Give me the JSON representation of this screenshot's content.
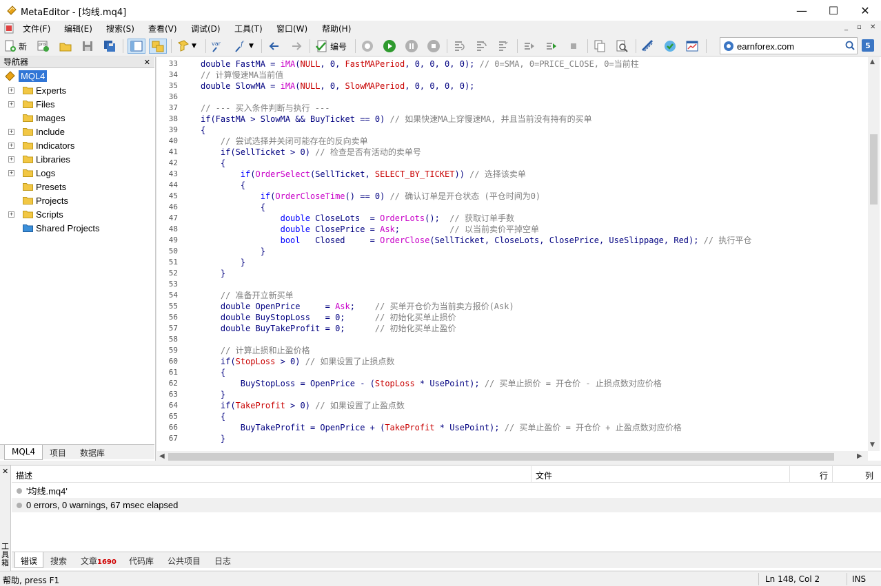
{
  "window": {
    "title": "MetaEditor - [均线.mq4]",
    "minimize": "—",
    "maximize": "☐",
    "close": "✕"
  },
  "menu": {
    "items": [
      "文件(F)",
      "编辑(E)",
      "搜索(S)",
      "查看(V)",
      "调试(D)",
      "工具(T)",
      "窗口(W)",
      "帮助(H)"
    ],
    "mdi": [
      "_",
      "▫",
      "✕"
    ]
  },
  "toolbar": {
    "new_label": "新",
    "compile_label": "编号",
    "search_value": "earnforex.com",
    "help_label": "5"
  },
  "navigator": {
    "header": "导航器",
    "close": "✕",
    "root": "MQL4",
    "items": [
      "Experts",
      "Files",
      "Images",
      "Include",
      "Indicators",
      "Libraries",
      "Logs",
      "Presets",
      "Projects",
      "Scripts",
      "Shared Projects"
    ],
    "tabs": [
      "MQL4",
      "项目",
      "数据库"
    ]
  },
  "editor": {
    "line_numbers": [
      "33",
      "34",
      "35",
      "36",
      "37",
      "38",
      "39",
      "40",
      "41",
      "42",
      "43",
      "44",
      "45",
      "46",
      "47",
      "48",
      "49",
      "50",
      "51",
      "52",
      "53",
      "54",
      "55",
      "56",
      "57",
      "58",
      "59",
      "60",
      "61",
      "62",
      "63",
      "64",
      "65",
      "66",
      "67"
    ]
  },
  "toolbox": {
    "side_close": "✕",
    "side_label": "工具箱",
    "columns": [
      "描述",
      "文件",
      "行",
      "列"
    ],
    "messages": [
      "'均线.mq4'",
      "0 errors, 0 warnings, 67 msec elapsed"
    ],
    "tabs": [
      "错误",
      "搜索",
      "文章",
      "代码库",
      "公共项目",
      "日志"
    ],
    "articles_badge": "1690"
  },
  "status": {
    "help": "帮助, press F1",
    "position": "Ln 148, Col 2",
    "mode": "INS"
  },
  "colors": {
    "code_text": "#000080",
    "comment": "#808080",
    "function": "#c800c8",
    "keyword": "#0000ff",
    "constant": "#c80000",
    "selection": "#3176d6"
  }
}
